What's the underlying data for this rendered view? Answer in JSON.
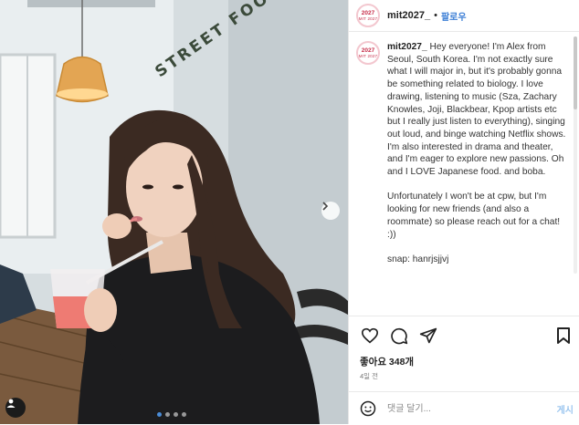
{
  "colors": {
    "accent": "#3d7fd6",
    "avatar_ring": "#f3c7cf",
    "post_disabled": "#9cc6ef"
  },
  "photo": {
    "wall_sign_text": "STREET FOOD",
    "carousel": {
      "count": 4,
      "active_index": 0
    },
    "icons": {
      "next": "chevron-right-icon",
      "tag": "user-tag-icon"
    }
  },
  "header": {
    "avatar": {
      "line1": "2027",
      "line2": "MIT 2027"
    },
    "username": "mit2027_",
    "separator": "•",
    "follow_label": "팔로우"
  },
  "caption": {
    "username": "mit2027_",
    "paragraphs": [
      "Hey everyone! I'm Alex from Seoul, South Korea. I'm not exactly sure what I will major in, but it's probably gonna be something related to biology. I love drawing, listening to music (Sza, Zachary Knowles, Joji, Blackbear, Kpop artists etc but I really just listen to everything), singing out loud, and binge watching Netflix shows. I'm also interested in drama and theater, and I'm eager to explore new passions. Oh and I LOVE Japanese food. and boba.",
      "Unfortunately I won't be at cpw, but I'm looking for new friends (and also a roommate) so please reach out for a chat! :))",
      "snap: hanrjsjjvj"
    ]
  },
  "actions": {
    "icons": [
      "heart-icon",
      "comment-icon",
      "share-icon",
      "bookmark-icon"
    ],
    "likes": "좋아요 348개",
    "time": "4일 전"
  },
  "comment": {
    "placeholder": "댓글 달기...",
    "post_label": "게시",
    "emoji_icon": "emoji-icon"
  }
}
